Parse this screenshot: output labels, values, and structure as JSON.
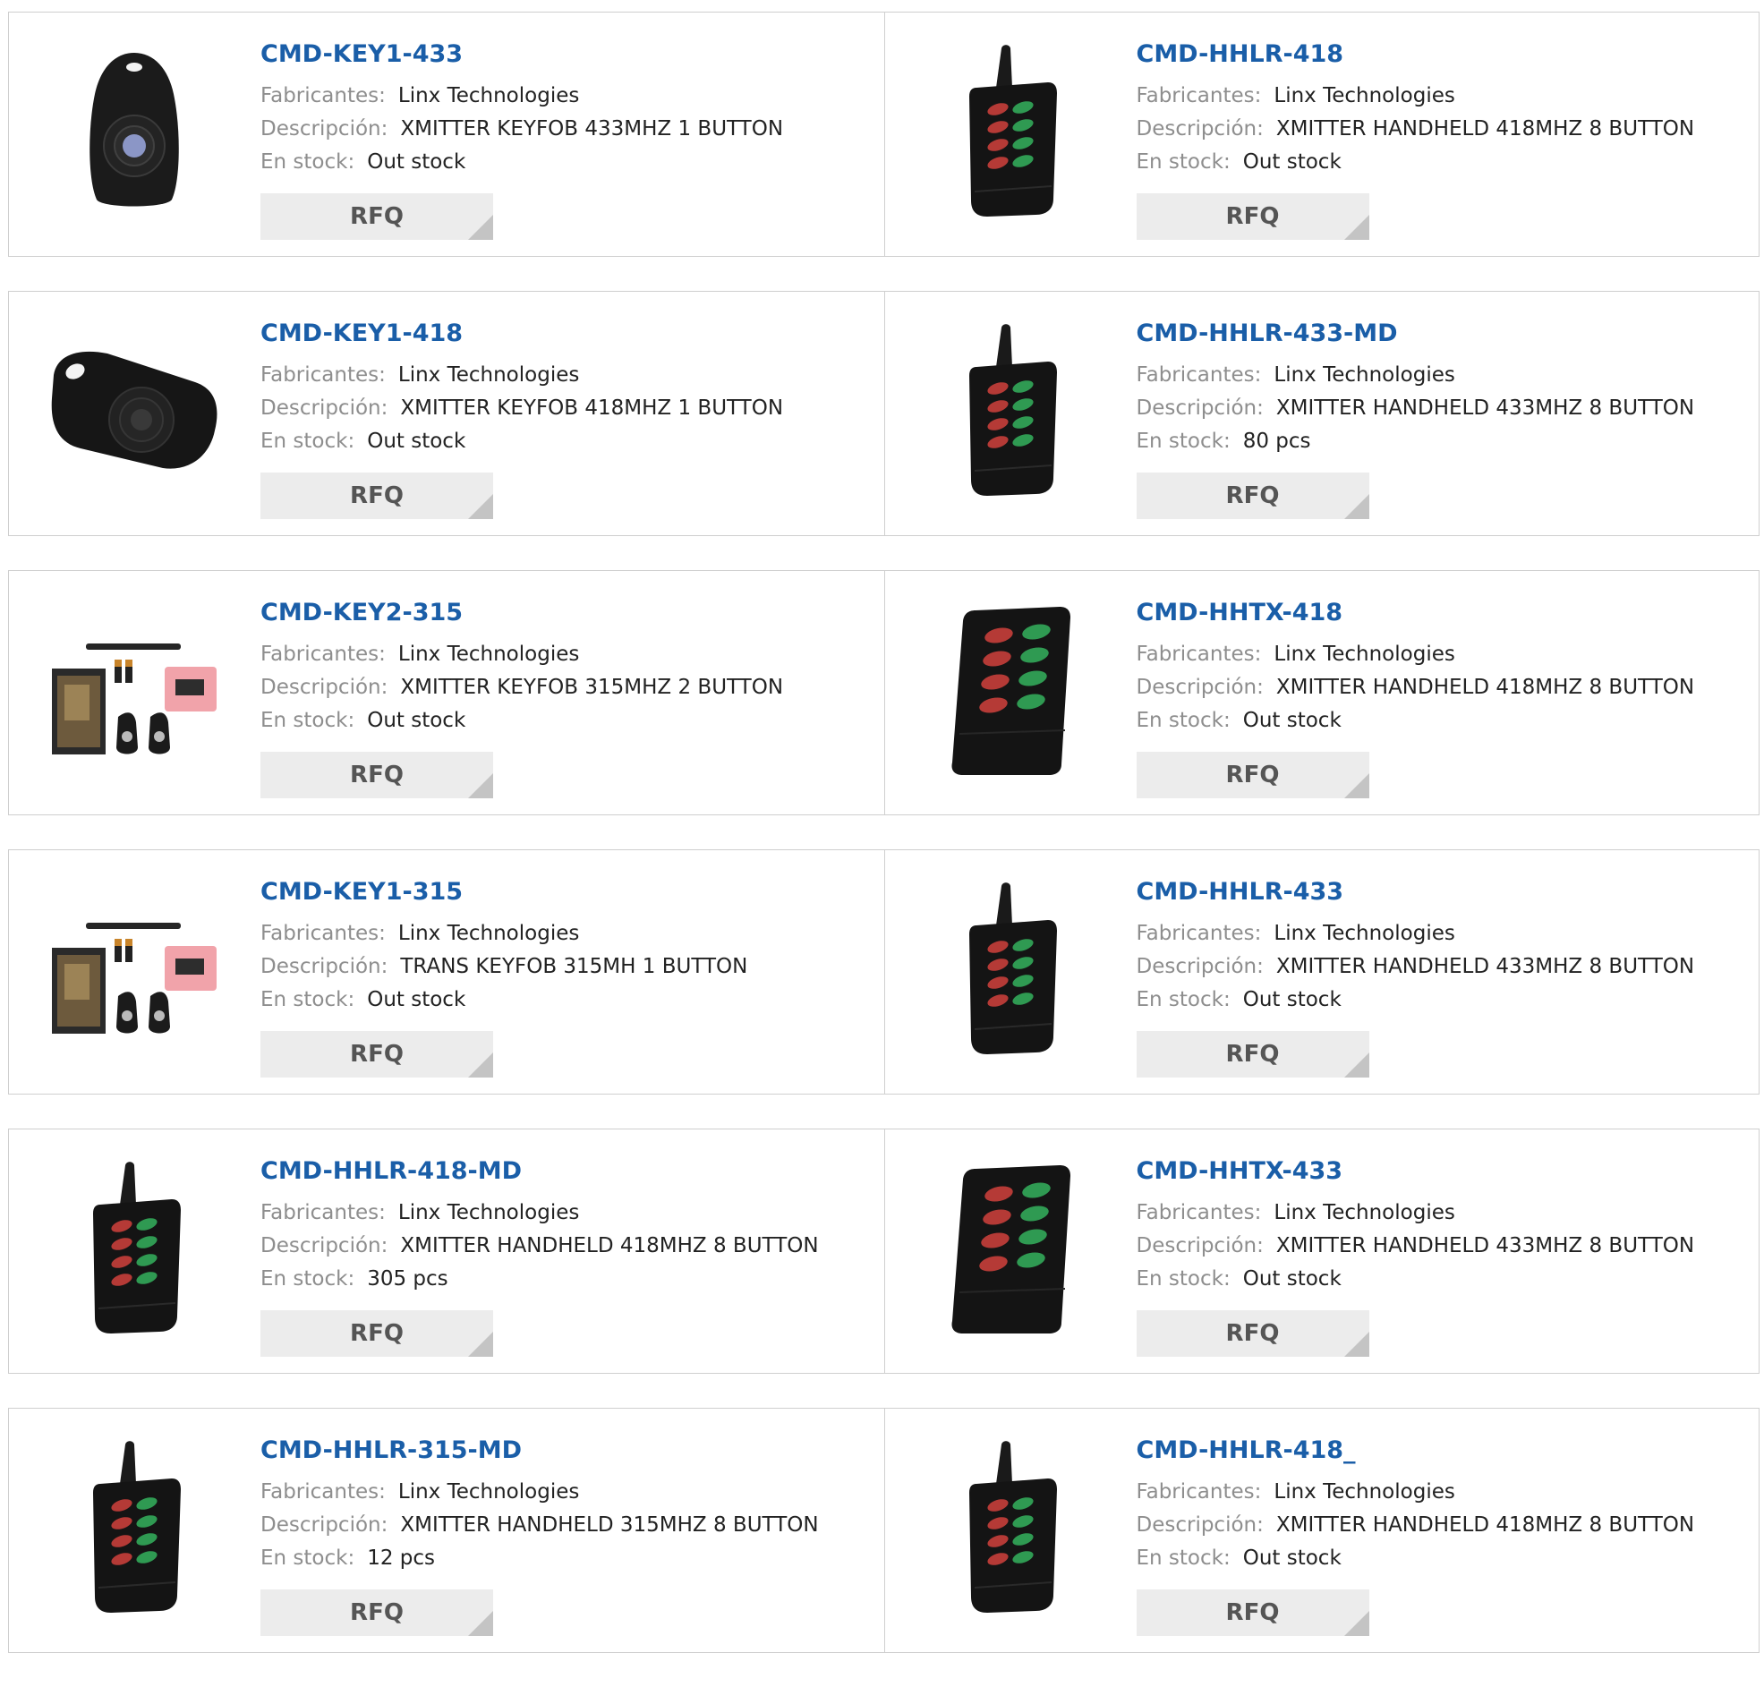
{
  "labels": {
    "manufacturer": "Fabricantes:",
    "description": "Descripción:",
    "stock": "En stock:",
    "rfq": "RFQ"
  },
  "products": [
    {
      "part": "CMD-KEY1-433",
      "manufacturer": "Linx Technologies",
      "description": "XMITTER KEYFOB 433MHZ 1 BUTTON",
      "stock": "Out stock",
      "image": "keyfob-1-button-vertical"
    },
    {
      "part": "CMD-HHLR-418",
      "manufacturer": "Linx Technologies",
      "description": "XMITTER HANDHELD 418MHZ 8 BUTTON",
      "stock": "Out stock",
      "image": "handheld-antenna-remote"
    },
    {
      "part": "CMD-KEY1-418",
      "manufacturer": "Linx Technologies",
      "description": "XMITTER KEYFOB 418MHZ 1 BUTTON",
      "stock": "Out stock",
      "image": "keyfob-1-button-horizontal"
    },
    {
      "part": "CMD-HHLR-433-MD",
      "manufacturer": "Linx Technologies",
      "description": "XMITTER HANDHELD 433MHZ 8 BUTTON",
      "stock": "80 pcs",
      "image": "handheld-antenna-remote"
    },
    {
      "part": "CMD-KEY2-315",
      "manufacturer": "Linx Technologies",
      "description": "XMITTER KEYFOB 315MHZ 2 BUTTON",
      "stock": "Out stock",
      "image": "keyfob-kit"
    },
    {
      "part": "CMD-HHTX-418",
      "manufacturer": "Linx Technologies",
      "description": "XMITTER HANDHELD 418MHZ 8 BUTTON",
      "stock": "Out stock",
      "image": "handheld-box-remote"
    },
    {
      "part": "CMD-KEY1-315",
      "manufacturer": "Linx Technologies",
      "description": "TRANS KEYFOB 315MH 1 BUTTON",
      "stock": "Out stock",
      "image": "keyfob-kit"
    },
    {
      "part": "CMD-HHLR-433",
      "manufacturer": "Linx Technologies",
      "description": "XMITTER HANDHELD 433MHZ 8 BUTTON",
      "stock": "Out stock",
      "image": "handheld-antenna-remote"
    },
    {
      "part": "CMD-HHLR-418-MD",
      "manufacturer": "Linx Technologies",
      "description": "XMITTER HANDHELD 418MHZ 8 BUTTON",
      "stock": "305 pcs",
      "image": "handheld-antenna-remote"
    },
    {
      "part": "CMD-HHTX-433",
      "manufacturer": "Linx Technologies",
      "description": "XMITTER HANDHELD 433MHZ 8 BUTTON",
      "stock": "Out stock",
      "image": "handheld-box-remote"
    },
    {
      "part": "CMD-HHLR-315-MD",
      "manufacturer": "Linx Technologies",
      "description": "XMITTER HANDHELD 315MHZ 8 BUTTON",
      "stock": "12 pcs",
      "image": "handheld-antenna-remote"
    },
    {
      "part": "CMD-HHLR-418_",
      "manufacturer": "Linx Technologies",
      "description": "XMITTER HANDHELD 418MHZ 8 BUTTON",
      "stock": "Out stock",
      "image": "handheld-antenna-remote"
    }
  ]
}
